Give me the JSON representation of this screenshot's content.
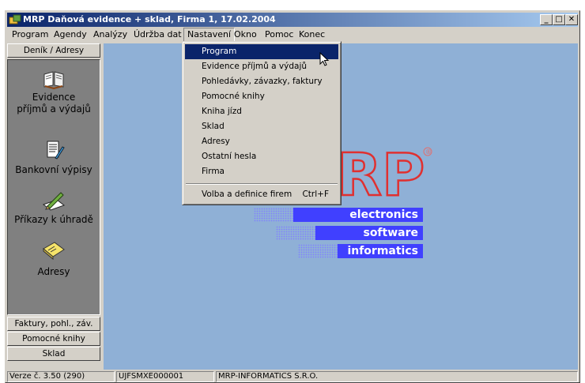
{
  "window": {
    "title": "MRP Daňová evidence + sklad, Firma 1, 17.02.2004",
    "controls": [
      "minimize",
      "maximize",
      "close"
    ]
  },
  "menubar": {
    "items": [
      {
        "label": "Program"
      },
      {
        "label": "Agendy"
      },
      {
        "label": "Analýzy"
      },
      {
        "label": "Údržba dat"
      },
      {
        "label": "Nastavení",
        "open": true
      },
      {
        "label": "Okno"
      },
      {
        "label": "Pomoc"
      },
      {
        "label": "Konec"
      }
    ]
  },
  "sidebar": {
    "top_header": "Deník / Adresy",
    "items": [
      {
        "label": "Evidence příjmů a výdajů",
        "icon": "open-book-icon"
      },
      {
        "label": "Bankovní výpisy",
        "icon": "document-pen-icon"
      },
      {
        "label": "Příkazy k úhradě",
        "icon": "pen-order-icon"
      },
      {
        "label": "Adresy",
        "icon": "envelope-icon"
      }
    ],
    "bottom_headers": [
      "Faktury, pohl., záv.",
      "Pomocné knihy",
      "Sklad"
    ]
  },
  "dropdown": {
    "items": [
      {
        "label": "Program",
        "selected": true
      },
      {
        "label": "Evidence příjmů a výdajů"
      },
      {
        "label": "Pohledávky, závazky, faktury"
      },
      {
        "label": "Pomocné knihy"
      },
      {
        "label": "Kniha jízd"
      },
      {
        "label": "Sklad"
      },
      {
        "label": "Adresy"
      },
      {
        "label": "Ostatní hesla"
      },
      {
        "label": "Firma"
      }
    ],
    "after_separator": {
      "label": "Volba a definice firem",
      "shortcut": "Ctrl+F"
    }
  },
  "logo": {
    "mark": "RP",
    "registered": "®",
    "lines": [
      "electronics",
      "software",
      "informatics"
    ]
  },
  "statusbar": {
    "version": "Verze č. 3.50 (290)",
    "code": "UJFSMXE000001",
    "company": "MRP-INFORMATICS S.R.O."
  },
  "colors": {
    "titlebar_start": "#0a246a",
    "titlebar_end": "#a6caf0",
    "client_bg": "#8fb0d6",
    "sidebar_panel": "#808080",
    "logo_blue": "#4040ff",
    "logo_red": "#e03030",
    "menu_highlight": "#0a246a"
  }
}
